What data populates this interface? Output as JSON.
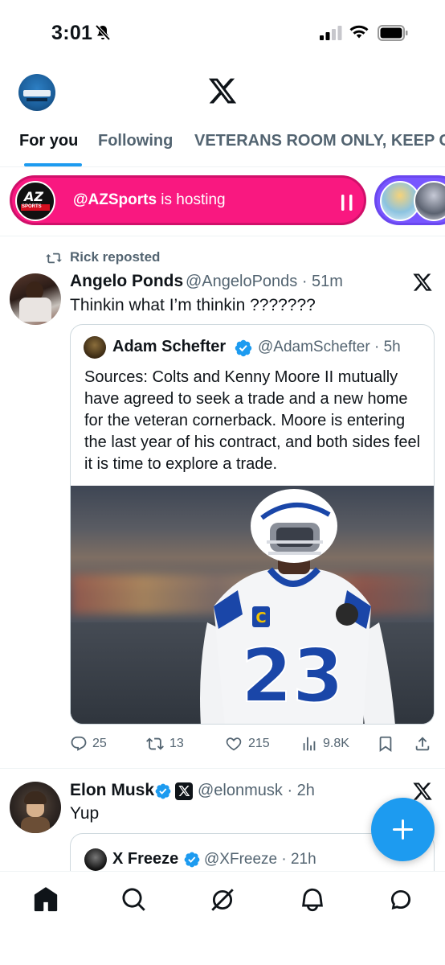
{
  "status_bar": {
    "time": "3:01",
    "icons": [
      "bell-off-icon",
      "signal-icon",
      "wifi-icon",
      "battery-icon"
    ]
  },
  "header": {
    "logo": "x-logo-icon",
    "profile_avatar": "profile-avatar"
  },
  "tabs": [
    {
      "label": "For you",
      "active": true
    },
    {
      "label": "Following",
      "active": false
    },
    {
      "label": "VETERANS ROOM ONLY, KEEP C",
      "active": false
    }
  ],
  "spaces": {
    "host_handle": "@AZSports",
    "host_suffix": " is hosting",
    "host_logo_text": "AZ",
    "host_logo_sub": "SPORTS",
    "color": "#f91880",
    "second_space_color": "#7856ff"
  },
  "tweet1": {
    "repost_label": "Rick reposted",
    "author_name": "Angelo Ponds",
    "author_handle_time": "@AngeloPonds · 51m",
    "text": "Thinkin what I’m thinkin ???????",
    "quote": {
      "name": "Adam Schefter",
      "handle_time": "@AdamSchefter · 5h",
      "text": "Sources: Colts and Kenny Moore II mutually have agreed to seek a trade and a new home for the veteran cornerback. Moore is entering the last year of his contract, and both sides feel it is time to explore a trade.",
      "jersey_number": "23",
      "jersey_patch": "C"
    },
    "actions": {
      "replies": "25",
      "reposts": "13",
      "likes": "215",
      "views": "9.8K"
    }
  },
  "tweet2": {
    "author_name": "Elon Musk",
    "author_handle_time": "@elonmusk · 2h",
    "text": "Yup",
    "quote": {
      "name": "X Freeze",
      "handle_time": "@XFreeze · 21h"
    }
  },
  "colors": {
    "accent": "#1d9bf0",
    "text": "#0f1419",
    "secondary": "#536471",
    "verified": "#1d9bf0"
  },
  "bottom_nav": [
    "home-icon",
    "search-icon",
    "grok-icon",
    "notifications-icon",
    "messages-icon"
  ]
}
